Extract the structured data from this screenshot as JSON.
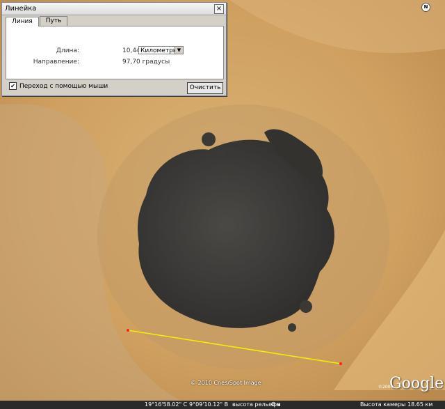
{
  "window": {
    "title": "Линейка",
    "close": "×"
  },
  "tabs": [
    {
      "label": "Линия"
    },
    {
      "label": "Путь"
    }
  ],
  "measure": {
    "length_label": "Длина:",
    "length_value": "10,44",
    "unit": "Километры",
    "heading_label": "Направление:",
    "heading_value": "97,70 градусы"
  },
  "mouse_nav": {
    "label": "Переход с помощью мыши",
    "checked": true
  },
  "clear_button": "Очистить",
  "map": {
    "north_label": "N",
    "copyright": "© 2010 Cnes/Spot Image",
    "logo": "Google",
    "logo_year": "©2009",
    "line_color": "#f2f200"
  },
  "status": {
    "latitude": "19°16'58.02\" С",
    "longitude": "9°09'10.12\" В",
    "elevation": "высота рельефа",
    "elevation_value": "0 м",
    "camera": "Высота камеры",
    "camera_value": "18.65 км"
  }
}
